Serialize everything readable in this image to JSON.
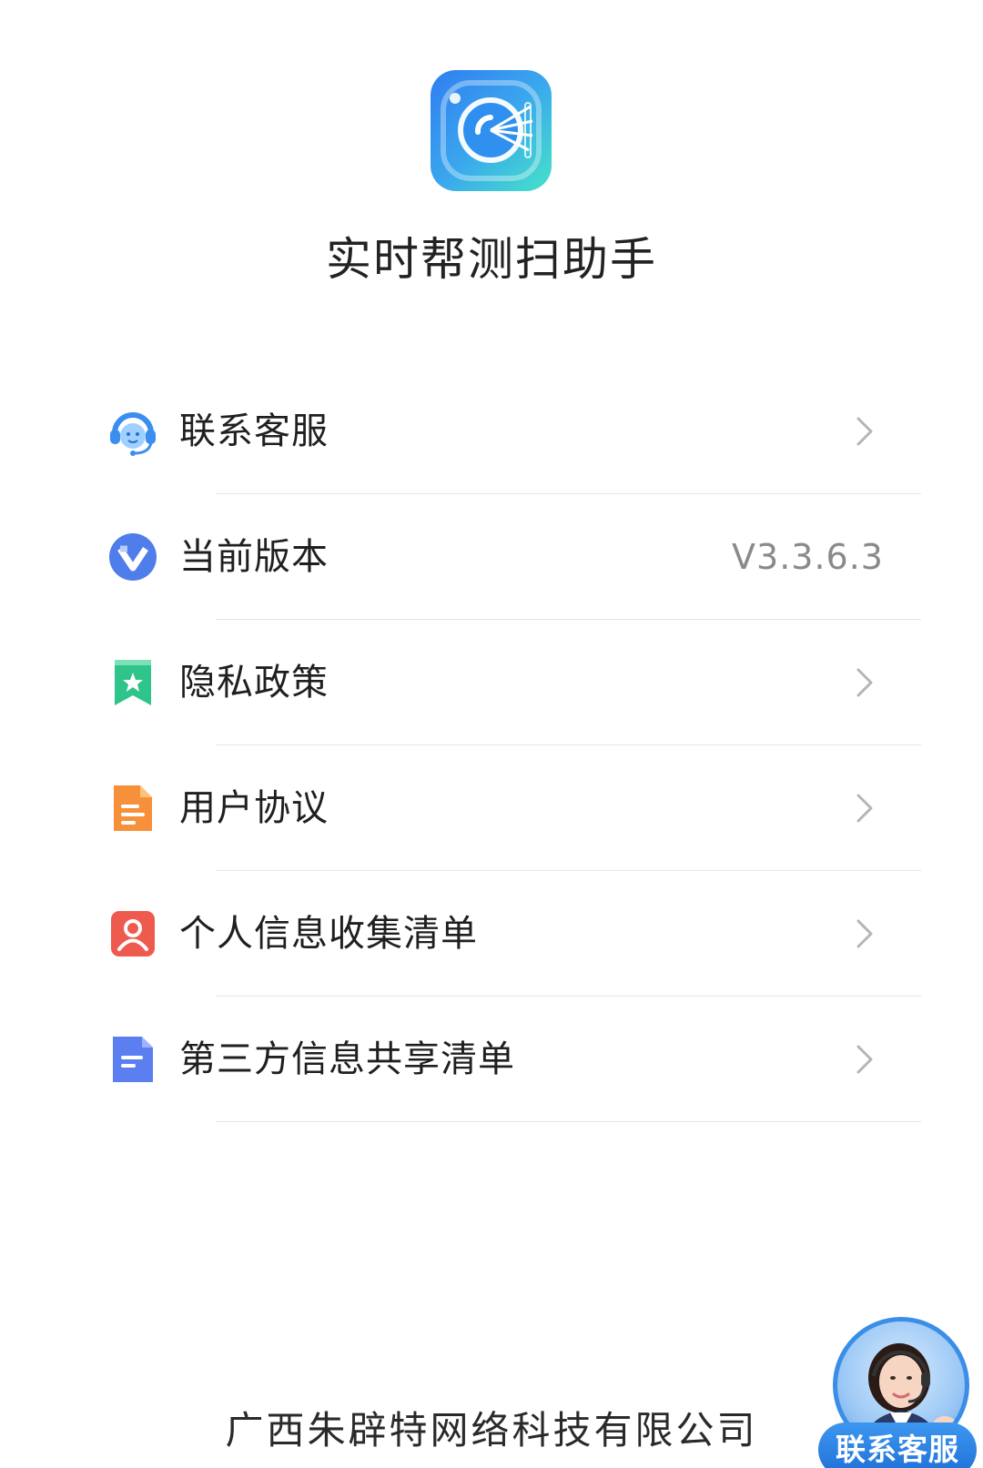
{
  "app": {
    "name": "实时帮测扫助手"
  },
  "menu": {
    "items": [
      {
        "label": "联系客服",
        "icon": "headset-icon",
        "has_chevron": true
      },
      {
        "label": "当前版本",
        "icon": "version-icon",
        "value": "V3.3.6.3"
      },
      {
        "label": "隐私政策",
        "icon": "bookmark-star-icon",
        "has_chevron": true
      },
      {
        "label": "用户协议",
        "icon": "document-icon",
        "has_chevron": true
      },
      {
        "label": "个人信息收集清单",
        "icon": "person-icon",
        "has_chevron": true
      },
      {
        "label": "第三方信息共享清单",
        "icon": "doc-list-icon",
        "has_chevron": true
      }
    ]
  },
  "footer": {
    "company": "广西朱辟特网络科技有限公司"
  },
  "floating_service": {
    "label": "联系客服"
  },
  "colors": {
    "text_primary": "#1f1f1f",
    "text_secondary": "#8a8a8a",
    "divider": "#e6e6e6",
    "headset_blue": "#3b8ef0",
    "version_blue": "#4f7de9",
    "privacy_green": "#2fc48a",
    "agreement_orange": "#f7903a",
    "personal_red": "#ef5a4f",
    "third_party_blue": "#5b7ff0"
  }
}
